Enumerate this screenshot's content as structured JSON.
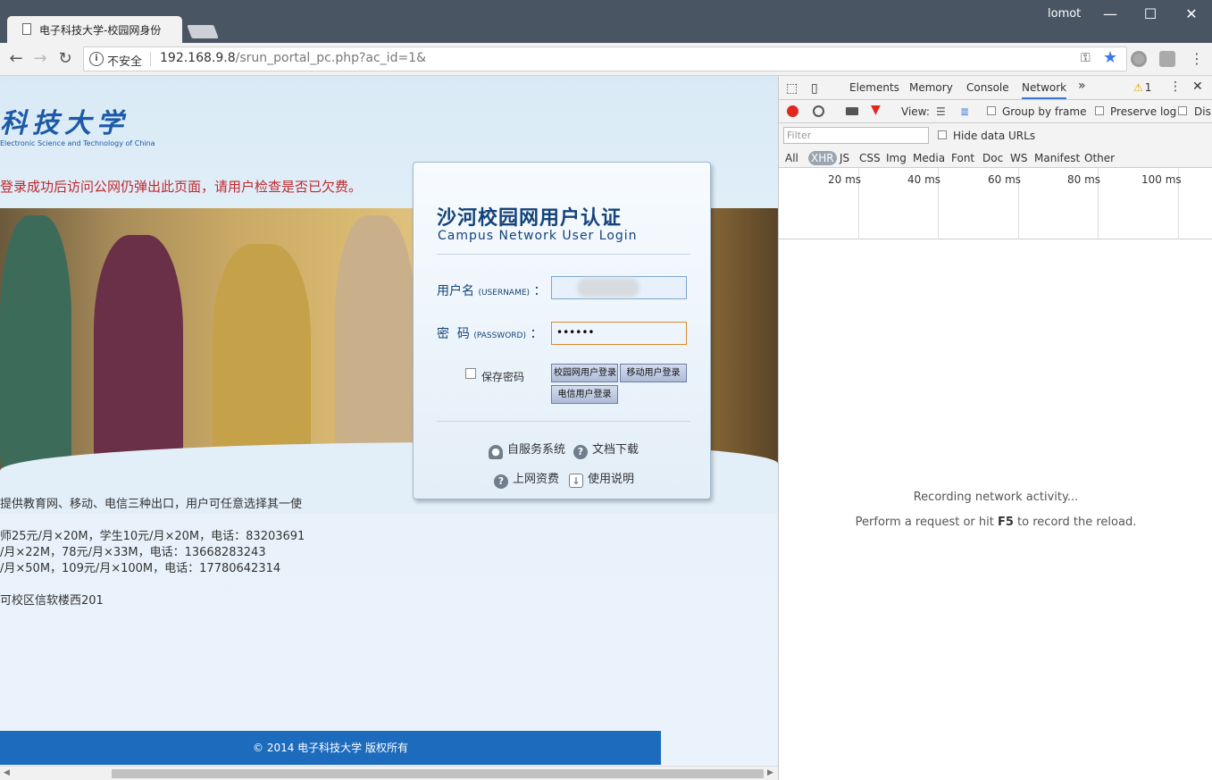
{
  "browser": {
    "tab_title": "电子科技大学-校园网身份",
    "user": "lomot",
    "insecure_label": "不安全",
    "url_host": "192.168.9.8",
    "url_rest": "/srun_portal_pc.php?ac_id=1&",
    "buttons": {
      "minimize": "—",
      "maximize": "☐",
      "close": "✕"
    }
  },
  "page": {
    "logo_cn": "科技大学",
    "logo_en": "Electronic Science and Technology of China",
    "notice": "登录成功后访问公网仍弹出此页面，请用户检查是否已欠费。",
    "info_lines": [
      "提供教育网、移动、电信三种出口，用户可任意选择其一使",
      "",
      "师25元/月×20M，学生10元/月×20M，电话：83203691",
      "/月×22M，78元/月×33M，电话：13668283243",
      "/月×50M，109元/月×100M，电话：17780642314",
      "",
      "",
      "可校区信软楼西201"
    ],
    "footer": "© 2014 电子科技大学 版权所有"
  },
  "login": {
    "title": "沙河校园网用户认证",
    "subtitle": "Campus Network User Login",
    "username_label": "用户名",
    "username_hint": "(USERNAME)",
    "password_label": "密  码",
    "password_hint": "(PASSWORD)",
    "colon": "：",
    "password_value": "••••••",
    "remember_label": "保存密码",
    "btn_campus": "校园网用户登录",
    "btn_mobile": "移动用户登录",
    "btn_telecom": "电信用户登录",
    "link_self_service": "自服务系统",
    "link_docs": "文档下载",
    "link_fees": "上网资费",
    "link_manual": "使用说明"
  },
  "devtools": {
    "tabs": [
      "Elements",
      "Memory",
      "Console",
      "Network"
    ],
    "selected_tab": "Network",
    "more": "»",
    "warning_count": "1",
    "view_label": "View:",
    "group_by_frame": "Group by frame",
    "preserve_log": "Preserve log",
    "disable_cache": "Dis",
    "filter_placeholder": "Filter",
    "hide_data_urls": "Hide data URLs",
    "types": [
      "All",
      "XHR",
      "JS",
      "CSS",
      "Img",
      "Media",
      "Font",
      "Doc",
      "WS",
      "Manifest",
      "Other"
    ],
    "selected_type": "XHR",
    "timeline_labels": [
      "20 ms",
      "40 ms",
      "60 ms",
      "80 ms",
      "100 ms"
    ],
    "msg_recording": "Recording network activity...",
    "msg_perform_pre": "Perform a request or hit ",
    "msg_key": "F5",
    "msg_perform_post": " to record the reload."
  },
  "colors": {
    "accent": "#3879d9",
    "brand": "#1d6bbd",
    "notice": "#c0282d"
  }
}
